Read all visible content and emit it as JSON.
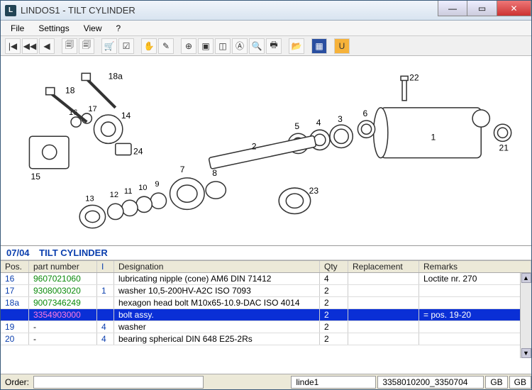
{
  "window": {
    "title": "LINDOS1 - TILT CYLINDER",
    "app_icon": "L"
  },
  "menu": {
    "file": "File",
    "settings": "Settings",
    "view": "View",
    "help": "?"
  },
  "toolbar_icons": {
    "first": "|◀",
    "rewind": "◀◀",
    "prev": "◀",
    "doc1": "🗐",
    "doc2": "🗐",
    "cart": "🛒",
    "check": "☑",
    "nohand": "✋",
    "hand": "✎",
    "zoomin": "⊕",
    "zoomsel": "▣",
    "zoomfit": "◫",
    "find": "Ⓐ",
    "findq": "🔍",
    "print": "🖶",
    "open": "📂",
    "eu": "▦",
    "u": "U"
  },
  "diagram_hint": "exploded view – tilt cylinder assembly",
  "grid": {
    "code": "07/04",
    "title": "TILT CYLINDER",
    "headers": {
      "pos": "Pos.",
      "pn": "part number",
      "i": "I",
      "des": "Designation",
      "qty": "Qty",
      "rep": "Replacement",
      "rem": "Remarks"
    },
    "rows": [
      {
        "pos": "16",
        "pn": "9607021060",
        "pnc": "link-g",
        "i": "",
        "des": "lubricating nipple (cone) AM6  DIN 71412",
        "qty": "4",
        "rep": "",
        "rem": "Loctite nr. 270"
      },
      {
        "pos": "17",
        "pn": "9308003020",
        "pnc": "link-g",
        "i": "1",
        "des": "washer 10,5-200HV-A2C  ISO 7093",
        "qty": "2",
        "rep": "",
        "rem": ""
      },
      {
        "pos": "18a",
        "pn": "9007346249",
        "pnc": "link-g",
        "i": "",
        "des": "hexagon head bolt M10x65-10.9-DAC  ISO 4014",
        "qty": "2",
        "rep": "",
        "rem": ""
      },
      {
        "pos": "",
        "pn": "3354903000",
        "pnc": "link-m",
        "i": "",
        "des": "bolt assy.",
        "qty": "2",
        "rep": "",
        "rem": "= pos. 19-20",
        "selected": true
      },
      {
        "pos": "19",
        "pn": "-",
        "pnc": "",
        "i": "4",
        "des": "washer",
        "qty": "2",
        "rep": "",
        "rem": ""
      },
      {
        "pos": "20",
        "pn": "-",
        "pnc": "",
        "i": "4",
        "des": "bearing spherical DIN 648 E25-2Rs",
        "qty": "2",
        "rep": "",
        "rem": ""
      }
    ]
  },
  "status": {
    "order_label": "Order:",
    "order_value": "",
    "user": "linde1",
    "file": "3358010200_3350704",
    "lang1": "GB",
    "lang2": "GB"
  }
}
